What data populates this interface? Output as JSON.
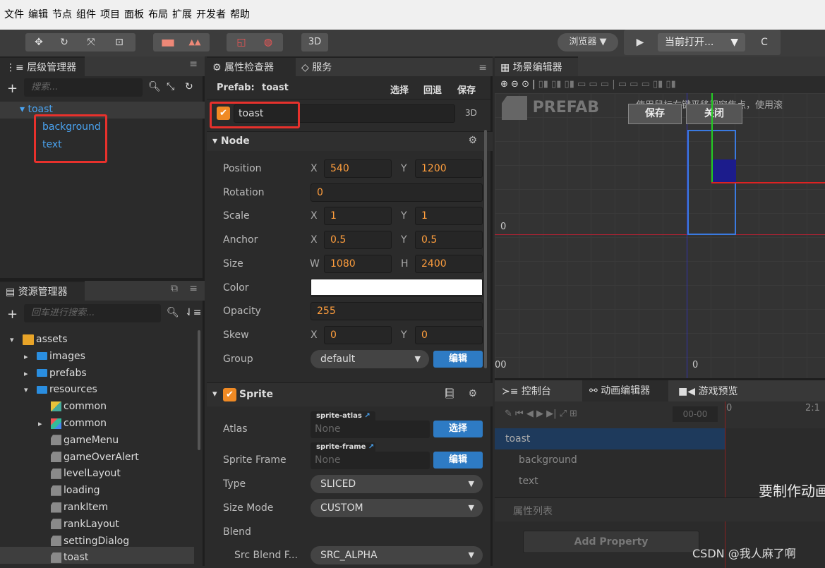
{
  "menu": [
    "文件",
    "编辑",
    "节点",
    "组件",
    "项目",
    "面板",
    "布局",
    "扩展",
    "开发者",
    "帮助"
  ],
  "toolbar": {
    "mode_3d": "3D",
    "browser": "浏览器 ▼",
    "current_open": "当前打开...",
    "play_icon": "play-icon",
    "refresh_icon": "refresh-icon"
  },
  "hierarchy": {
    "title": "层级管理器",
    "search_placeholder": "搜索...",
    "root": "toast",
    "children": [
      "background",
      "text"
    ]
  },
  "assets": {
    "title": "资源管理器",
    "search_placeholder": "回车进行搜索...",
    "items": [
      {
        "label": "assets",
        "depth": 0,
        "arrow": "▾",
        "icon": "folder-icon"
      },
      {
        "label": "images",
        "depth": 1,
        "arrow": "▸",
        "icon": "folder-icon"
      },
      {
        "label": "prefabs",
        "depth": 1,
        "arrow": "▸",
        "icon": "folder-icon"
      },
      {
        "label": "resources",
        "depth": 1,
        "arrow": "▾",
        "icon": "folder-icon"
      },
      {
        "label": "common",
        "depth": 2,
        "arrow": "",
        "icon": "atlas-icon"
      },
      {
        "label": "common",
        "depth": 2,
        "arrow": "▸",
        "icon": "image-icon"
      },
      {
        "label": "gameMenu",
        "depth": 2,
        "arrow": "",
        "icon": "prefab-icon"
      },
      {
        "label": "gameOverAlert",
        "depth": 2,
        "arrow": "",
        "icon": "prefab-icon"
      },
      {
        "label": "levelLayout",
        "depth": 2,
        "arrow": "",
        "icon": "prefab-icon"
      },
      {
        "label": "loading",
        "depth": 2,
        "arrow": "",
        "icon": "prefab-icon"
      },
      {
        "label": "rankItem",
        "depth": 2,
        "arrow": "",
        "icon": "prefab-icon"
      },
      {
        "label": "rankLayout",
        "depth": 2,
        "arrow": "",
        "icon": "prefab-icon"
      },
      {
        "label": "settingDialog",
        "depth": 2,
        "arrow": "",
        "icon": "prefab-icon"
      },
      {
        "label": "toast",
        "depth": 2,
        "arrow": "",
        "icon": "prefab-icon"
      }
    ]
  },
  "inspector": {
    "title": "属性检查器",
    "service_tab": "服务",
    "prefab_label": "Prefab:",
    "prefab_name": "toast",
    "select": "选择",
    "revert": "回退",
    "save": "保存",
    "node_name": "toast",
    "mode_3d": "3D",
    "node_section": "▾ Node",
    "fields": {
      "position": {
        "label": "Position",
        "x": "540",
        "y": "1200"
      },
      "rotation": {
        "label": "Rotation",
        "value": "0"
      },
      "scale": {
        "label": "Scale",
        "x": "1",
        "y": "1"
      },
      "anchor": {
        "label": "Anchor",
        "x": "0.5",
        "y": "0.5"
      },
      "size": {
        "label": "Size",
        "w": "1080",
        "h": "2400"
      },
      "color": {
        "label": "Color"
      },
      "opacity": {
        "label": "Opacity",
        "value": "255"
      },
      "skew": {
        "label": "Skew",
        "x": "0",
        "y": "0"
      },
      "group": {
        "label": "Group",
        "value": "default",
        "edit": "编辑"
      }
    },
    "axis": {
      "x": "X",
      "y": "Y",
      "w": "W",
      "h": "H"
    },
    "sprite_section": "Sprite",
    "sprite": {
      "atlas_label": "Atlas",
      "atlas_tag": "sprite-atlas",
      "atlas_value": "None",
      "atlas_btn": "选择",
      "frame_label": "Sprite Frame",
      "frame_tag": "sprite-frame",
      "frame_value": "None",
      "frame_btn": "编辑",
      "type_label": "Type",
      "type_value": "SLICED",
      "sizemode_label": "Size Mode",
      "sizemode_value": "CUSTOM",
      "blend_label": "Blend",
      "srcblend_label": "Src Blend F...",
      "srcblend_value": "SRC_ALPHA"
    }
  },
  "scene": {
    "title": "场景编辑器",
    "prefab_logo": "PREFAB",
    "save": "保存",
    "close": "关闭",
    "hint": "使用鼠标右键平移视窗焦点，使用滚",
    "tick_0_left": "0",
    "tick_0_bottom": "0",
    "tick_00": "00"
  },
  "bottom": {
    "console_tab": "控制台",
    "anim_tab": "动画编辑器",
    "preview_tab": "游戏预览",
    "time": "00-00",
    "t0": "0",
    "t1": "2:1",
    "rows": [
      "toast",
      "background",
      "text"
    ],
    "prop_list": "属性列表",
    "add_property": "Add Property",
    "big_hint": "要制作动画",
    "watermark": "CSDN @我人麻了啊"
  },
  "colors": {
    "accent": "#2e7bc4",
    "highlight_box": "#e8312c",
    "value_orange": "#ff9e3d"
  }
}
